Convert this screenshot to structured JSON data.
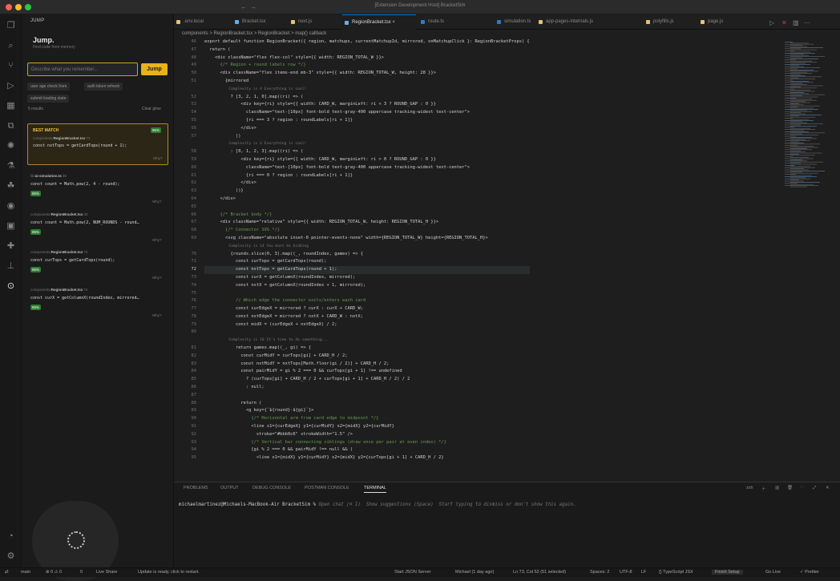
{
  "window": {
    "title": "[Extension Development Host] BracketSim"
  },
  "sidebar": {
    "header": "JUMP",
    "title": "Jump.",
    "subtitle": "Find code from memory",
    "input_placeholder": "Describe what you remember...",
    "jump_label": "Jump",
    "chips": [
      "user age check from",
      "auth token refresh",
      "submit loading state"
    ],
    "result_count": "5 results",
    "clear_label": "Clear glow",
    "best_match": {
      "label": "BEST MATCH",
      "pct": "95%",
      "path": "components/",
      "file": "RegionBracket.tsx",
      "line": ":73",
      "snippet": "const nxtTops = getCardTops(round + 1);",
      "why": "Why?"
    },
    "results": [
      {
        "path": "lib/",
        "file": "ai-simulation.ts",
        "line": ":30",
        "pct": "86%",
        "snippet": "const count = Math.pow(2, 4 - round);",
        "why": "Why?"
      },
      {
        "path": "components/",
        "file": "RegionBracket.tsx",
        "line": ":40",
        "pct": "85%",
        "snippet": "const count = Math.pow(2, NUM_ROUNDS - round…",
        "why": "Why?"
      },
      {
        "path": "components/",
        "file": "RegionBracket.tsx",
        "line": ":72",
        "pct": "85%",
        "snippet": "const curTops = getCardTops(round);",
        "why": "Why?"
      },
      {
        "path": "components/",
        "file": "RegionBracket.tsx",
        "line": ":74",
        "pct": "85%",
        "snippet": "const curX = getColumnX(roundIndex, mirrored…",
        "why": "Why?"
      }
    ]
  },
  "tabs": [
    {
      "label": ".env.local",
      "color": "#e5c07b"
    },
    {
      "label": "Bracket.tsx",
      "color": "#61afef"
    },
    {
      "label": "next.js",
      "color": "#e5c07b"
    },
    {
      "label": "RegionBracket.tsx",
      "color": "#61afef",
      "active": true
    },
    {
      "label": "route.ts",
      "color": "#3178c6"
    },
    {
      "label": "simulation.ts",
      "color": "#3178c6"
    },
    {
      "label": "app-pages-internals.js",
      "color": "#e5c07b"
    },
    {
      "label": "polyfills.js",
      "color": "#e5c07b"
    },
    {
      "label": "page.js",
      "color": "#e5c07b"
    }
  ],
  "breadcrumb": "components > RegionBracket.tsx > RegionBracket > map() callback",
  "editor": {
    "lines": [
      {
        "n": "46",
        "t": "export default function RegionBracket({ region, matchups, currentMatchupId, mirrored, onMatchupClick }: RegionBracketProps) {"
      },
      {
        "n": "47",
        "t": "  return ("
      },
      {
        "n": "48",
        "t": "    <div className=\"flex flex-col\" style={{ width: REGION_TOTAL_W }}>"
      },
      {
        "n": "49",
        "t": "      {/* Region + round labels row */}"
      },
      {
        "n": "50",
        "t": "      <div className=\"flex items-end mb-3\" style={{ width: REGION_TOTAL_W, height: 28 }}>"
      },
      {
        "n": "51",
        "t": "        {mirrored"
      },
      {
        "n": "",
        "t": "           Complexity is 4 Everything is cool!"
      },
      {
        "n": "52",
        "t": "          ? [3, 2, 1, 0].map((ri) => ("
      },
      {
        "n": "53",
        "t": "              <div key={ri} style={{ width: CARD_W, marginLeft: ri < 3 ? ROUND_GAP : 0 }}"
      },
      {
        "n": "54",
        "t": "                className=\"text-[10px] font-bold text-gray-400 uppercase tracking-widest text-center\">"
      },
      {
        "n": "55",
        "t": "                {ri === 3 ? region : roundLabels[ri + 1]}"
      },
      {
        "n": "56",
        "t": "              </div>"
      },
      {
        "n": "57",
        "t": "            ))"
      },
      {
        "n": "",
        "t": "           Complexity is 4 Everything is cool!"
      },
      {
        "n": "58",
        "t": "          : [0, 1, 2, 3].map((ri) => ("
      },
      {
        "n": "59",
        "t": "              <div key={ri} style={{ width: CARD_W, marginLeft: ri > 0 ? ROUND_GAP : 0 }}"
      },
      {
        "n": "60",
        "t": "                className=\"text-[10px] font-bold text-gray-400 uppercase tracking-widest text-center\">"
      },
      {
        "n": "61",
        "t": "                {ri === 0 ? region : roundLabels[ri + 1]}"
      },
      {
        "n": "62",
        "t": "              </div>"
      },
      {
        "n": "63",
        "t": "            ))}"
      },
      {
        "n": "64",
        "t": "      </div>"
      },
      {
        "n": "65",
        "t": ""
      },
      {
        "n": "66",
        "t": "      {/* Bracket body */}"
      },
      {
        "n": "67",
        "t": "      <div className=\"relative\" style={{ width: REGION_TOTAL_W, height: REGION_TOTAL_H }}>"
      },
      {
        "n": "68",
        "t": "        {/* Connector SVG */}"
      },
      {
        "n": "69",
        "t": "        <svg className=\"absolute inset-0 pointer-events-none\" width={REGION_TOTAL_W} height={REGION_TOTAL_H}>"
      },
      {
        "n": "",
        "t": "           Complexity is 14 You must be kidding"
      },
      {
        "n": "70",
        "t": "          {rounds.slice(0, 3).map((_, roundIndex, games) => {"
      },
      {
        "n": "71",
        "t": "            const curTops = getCardTops(round);"
      },
      {
        "n": "72",
        "t": "            const nxtTops = getCardTops(round + 1);"
      },
      {
        "n": "73",
        "t": "            const curX = getColumnX(roundIndex, mirrored);"
      },
      {
        "n": "74",
        "t": "            const nxtX = getColumnX(roundIndex + 1, mirrored);"
      },
      {
        "n": "75",
        "t": ""
      },
      {
        "n": "76",
        "t": "            // Which edge the connector exits/enters each card"
      },
      {
        "n": "77",
        "t": "            const curEdgeX = mirrored ? curX : curX + CARD_W;"
      },
      {
        "n": "78",
        "t": "            const nxtEdgeX = mirrored ? nxtX + CARD_W : nxtX;"
      },
      {
        "n": "79",
        "t": "            const midX = (curEdgeX + nxtEdgeX) / 2;"
      },
      {
        "n": "80",
        "t": ""
      },
      {
        "n": "",
        "t": "           Complexity is 10 It's time to do something..."
      },
      {
        "n": "81",
        "t": "            return games.map((_, gi) => {"
      },
      {
        "n": "82",
        "t": "              const curMidY = curTops[gi] + CARD_H / 2;"
      },
      {
        "n": "83",
        "t": "              const nxtMidY = nxtTops[Math.floor(gi / 2)] + CARD_H / 2;"
      },
      {
        "n": "84",
        "t": "              const pairMidY = gi % 2 === 0 && curTops[gi + 1] !== undefined"
      },
      {
        "n": "85",
        "t": "                ? (curTops[gi] + CARD_H / 2 + curTops[gi + 1] + CARD_H / 2) / 2"
      },
      {
        "n": "86",
        "t": "                : null;"
      },
      {
        "n": "87",
        "t": ""
      },
      {
        "n": "88",
        "t": "              return ("
      },
      {
        "n": "89",
        "t": "                <g key={`${round}-${gi}`}>"
      },
      {
        "n": "90",
        "t": "                  {/* Horizontal arm from card edge to midpoint */}"
      },
      {
        "n": "91",
        "t": "                  <line x1={curEdgeX} y1={curMidY} x2={midX} y2={curMidY}"
      },
      {
        "n": "92",
        "t": "                    stroke=\"#bbb0c6\" strokeWidth=\"1.5\" />"
      },
      {
        "n": "93",
        "t": "                  {/* Vertical bar connecting siblings (draw once per pair at even index) */}"
      },
      {
        "n": "94",
        "t": "                  {gi % 2 === 0 && pairMidY !== null && ("
      },
      {
        "n": "95",
        "t": "                    <line x1={midX} y1={curMidY} x2={midX} y2={curTops[gi + 1] + CARD_H / 2}"
      }
    ]
  },
  "panel": {
    "tabs": [
      "PROBLEMS",
      "OUTPUT",
      "DEBUG CONSOLE",
      "POSTMAN CONSOLE",
      "TERMINAL"
    ],
    "active_tab": "TERMINAL",
    "shell": "zsh",
    "prompt": "michaelmartinez@Michaels-MacBook-Air BracketSim % ",
    "hint": "Open chat (⌘ I)  Show suggestions (Space)  Start typing to dismiss or don't show this again."
  },
  "status": {
    "branch": "main",
    "errors": "⊗ 0 ⚠ 0",
    "ports": "0",
    "live": "Live Share",
    "update": "Update is ready, click to restart.",
    "json_server": "Start JSON Server",
    "author": "Michael (1 day ago)",
    "position": "Ln 73, Col 52 (51 selected)",
    "spaces": "Spaces: 2",
    "encoding": "UTF-8",
    "eol": "LF",
    "lang": "{} TypeScript JSX",
    "finish": "Finish Setup",
    "golive": "Go Live",
    "prettier": "✓ Prettier"
  }
}
